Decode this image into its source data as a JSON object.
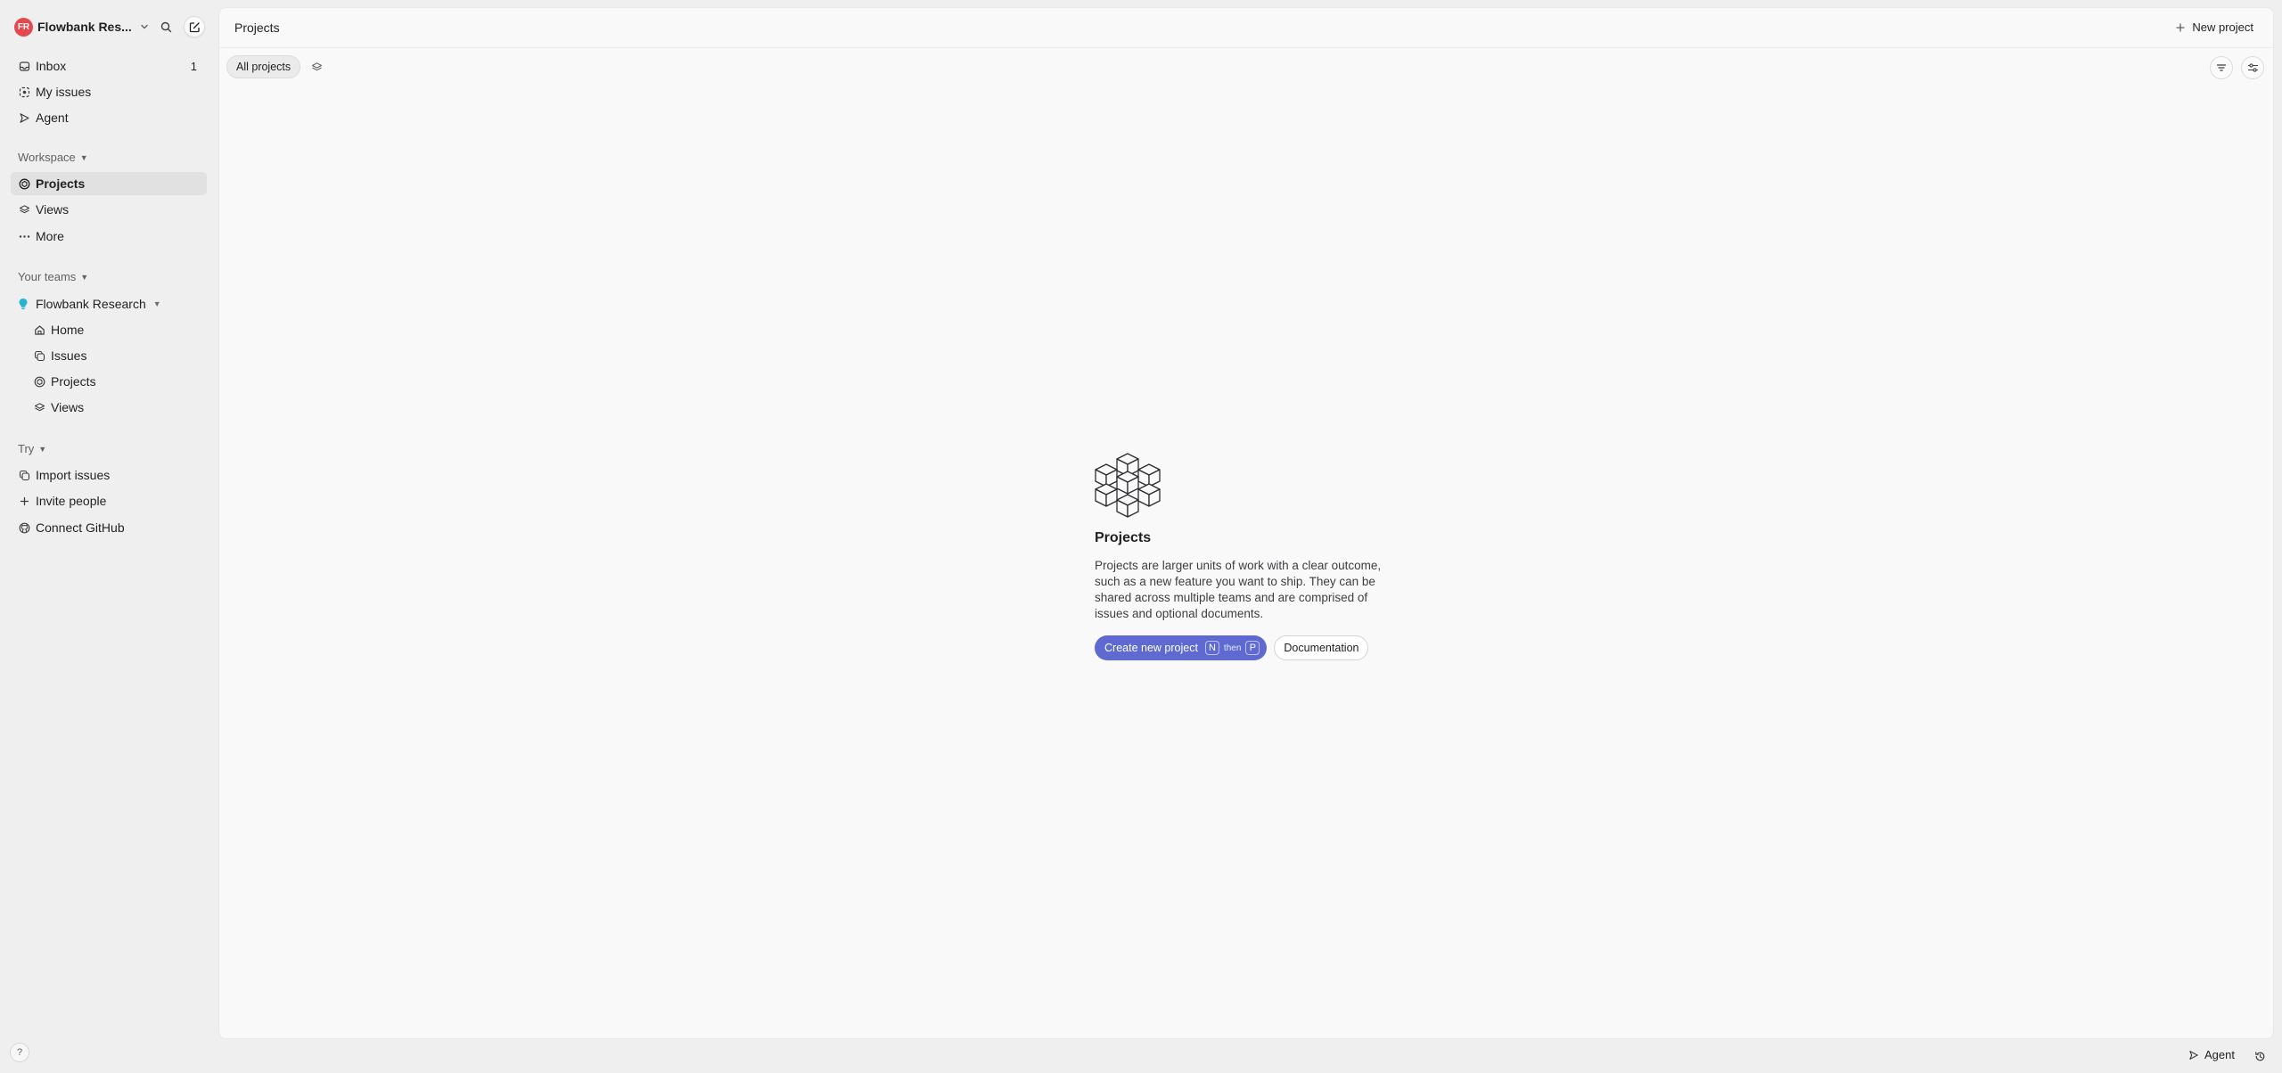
{
  "workspace": {
    "initials": "FR",
    "name": "Flowbank Res..."
  },
  "sidebar": {
    "top_items": [
      {
        "label": "Inbox",
        "badge": "1"
      },
      {
        "label": "My issues"
      },
      {
        "label": "Agent"
      }
    ],
    "workspace_section": {
      "heading": "Workspace",
      "items": [
        {
          "label": "Projects"
        },
        {
          "label": "Views"
        },
        {
          "label": "More"
        }
      ]
    },
    "teams_section": {
      "heading": "Your teams",
      "team_name": "Flowbank Research",
      "items": [
        {
          "label": "Home"
        },
        {
          "label": "Issues"
        },
        {
          "label": "Projects"
        },
        {
          "label": "Views"
        }
      ]
    },
    "try_section": {
      "heading": "Try",
      "items": [
        {
          "label": "Import issues"
        },
        {
          "label": "Invite people"
        },
        {
          "label": "Connect GitHub"
        }
      ]
    },
    "help_label": "?"
  },
  "header": {
    "title": "Projects",
    "new_project_label": "New project"
  },
  "toolbar": {
    "tab_all_projects": "All projects"
  },
  "empty_state": {
    "title": "Projects",
    "description": "Projects are larger units of work with a clear outcome, such as a new feature you want to ship. They can be shared across multiple teams and are comprised of issues and optional documents.",
    "primary_label": "Create new project",
    "shortcut_key_1": "N",
    "shortcut_then": "then",
    "shortcut_key_2": "P",
    "secondary_label": "Documentation"
  },
  "footer": {
    "agent_label": "Agent"
  },
  "colors": {
    "accent": "#5e6ad2",
    "avatar": "#e5484d",
    "team_icon": "#26b5ce"
  }
}
